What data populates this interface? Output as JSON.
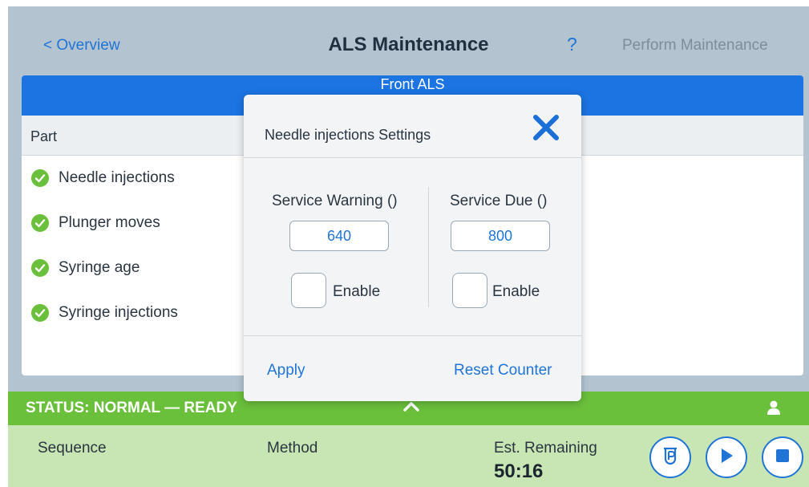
{
  "header": {
    "back_label": "< Overview",
    "title": "ALS Maintenance",
    "help_label": "?",
    "perform_label": "Perform Maintenance"
  },
  "panel": {
    "header_label": "Front ALS",
    "column_header": "Part",
    "parts": [
      {
        "label": "Needle injections",
        "status_icon": "check-circle-icon"
      },
      {
        "label": "Plunger moves",
        "status_icon": "check-circle-icon"
      },
      {
        "label": "Syringe age",
        "status_icon": "check-circle-icon"
      },
      {
        "label": "Syringe injections",
        "status_icon": "check-circle-icon"
      }
    ]
  },
  "modal": {
    "title": "Needle injections Settings",
    "warning": {
      "label": "Service Warning ()",
      "value": "640",
      "enable_label": "Enable",
      "enabled": false
    },
    "due": {
      "label": "Service Due ()",
      "value": "800",
      "enable_label": "Enable",
      "enabled": false
    },
    "apply_label": "Apply",
    "reset_label": "Reset Counter"
  },
  "status": {
    "text": "STATUS: NORMAL — READY"
  },
  "footer": {
    "sequence_label": "Sequence",
    "method_label": "Method",
    "remaining_label": "Est. Remaining",
    "remaining_value": "50:16"
  },
  "colors": {
    "accent": "#1b74e2",
    "status_green": "#6abf3b",
    "footer_green": "#c8e6b4",
    "background": "#b3c4d0"
  }
}
